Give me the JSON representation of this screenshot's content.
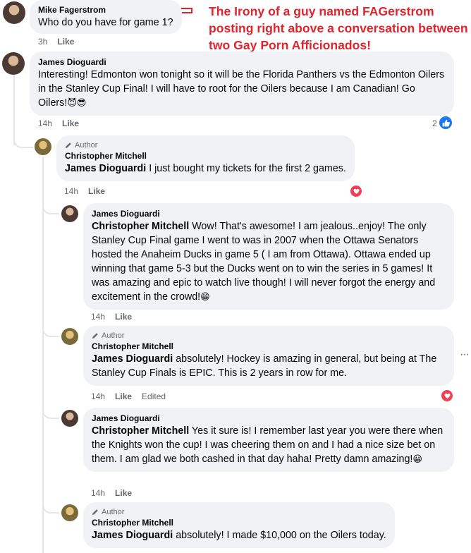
{
  "annotation": {
    "text": "The Irony of a guy named FAGerstrom posting right above a conversation between two Gay Porn Afficionados!",
    "color": "#e0242e"
  },
  "comments": [
    {
      "author": "Mike Fagerstrom",
      "text": "Who do you have for game 1?",
      "time": "3h",
      "like": "Like"
    },
    {
      "author": "James Dioguardi",
      "text": "Interesting! Edmonton won tonight so it will be the Florida Panthers vs the Edmonton Oilers in the Stanley Cup Final! I will have to root for the Oilers because I am Canadian! Go Oilers!",
      "emoji": "😈😎",
      "time": "14h",
      "like": "Like",
      "reaction_count": "2"
    },
    {
      "badge": "Author",
      "author": "Christopher Mitchell",
      "tag": "James Dioguardi",
      "text": " I just bought my tickets for the first 2 games.",
      "time": "14h",
      "like": "Like"
    },
    {
      "author": "James Dioguardi",
      "tag": "Christopher Mitchell",
      "text": " Wow! That's awesome! I am jealous..enjoy! The only Stanley Cup Final game I went to was in 2007 when the Ottawa Senators hosted the Anaheim Ducks in game 5 ( I am from Ottawa). Ottawa ended up winning that game 5-3 but the Ducks went on to win the series in 5 games! It was amazing and epic to watch live though! I will never forgot the energy and excitement in the crowd!",
      "emoji": "😁",
      "time": "14h",
      "like": "Like"
    },
    {
      "badge": "Author",
      "author": "Christopher Mitchell",
      "tag": "James Dioguardi",
      "text": " absolutely! Hockey is amazing in general, but being at The Stanley Cup Finals is EPIC. This is 2 years in row for me.",
      "time": "14h",
      "like": "Like",
      "edited": "Edited"
    },
    {
      "author": "James Dioguardi",
      "tag": "Christopher Mitchell",
      "text": " Yes it sure is! I remember last year you were there when the Knights won the cup! I was cheering them on and I had a nice size bet on them. I am glad we both cashed in that day haha! Pretty damn amazing!",
      "emoji": "😀",
      "time": "14h",
      "like": "Like"
    },
    {
      "badge": "Author",
      "author": "Christopher Mitchell",
      "tag": "James Dioguardi",
      "text": " absolutely! I made $10,000 on the Oilers today."
    }
  ],
  "colors": {
    "heart": "#f33e58",
    "like": "#1877f2",
    "bubble": "#f0f2f5",
    "meta": "#65676b"
  }
}
